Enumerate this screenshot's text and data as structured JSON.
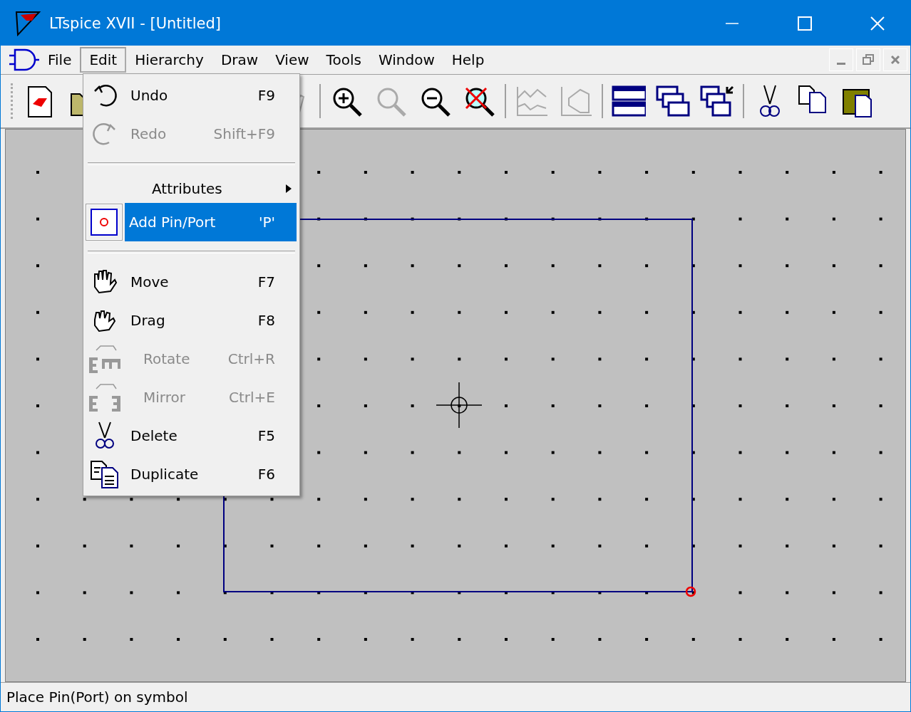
{
  "window": {
    "title": "LTspice XVII - [Untitled]"
  },
  "menu_bar": [
    {
      "label": "File",
      "selected": false
    },
    {
      "label": "Edit",
      "selected": true
    },
    {
      "label": "Hierarchy",
      "selected": false
    },
    {
      "label": "Draw",
      "selected": false
    },
    {
      "label": "View",
      "selected": false
    },
    {
      "label": "Tools",
      "selected": false
    },
    {
      "label": "Window",
      "selected": false
    },
    {
      "label": "Help",
      "selected": false
    }
  ],
  "edit_menu": [
    {
      "kind": "command",
      "label": "Undo",
      "shortcut": "F9",
      "disabled": false,
      "selected": false
    },
    {
      "kind": "command",
      "label": "Redo",
      "shortcut": "Shift+F9",
      "disabled": true,
      "selected": false
    },
    {
      "kind": "separator"
    },
    {
      "kind": "submenu",
      "label": "Attributes",
      "disabled": false,
      "selected": false
    },
    {
      "kind": "command",
      "label": "Add Pin/Port",
      "shortcut": "'P'",
      "disabled": false,
      "selected": true
    },
    {
      "kind": "separator"
    },
    {
      "kind": "command",
      "label": "Move",
      "shortcut": "F7",
      "disabled": false,
      "selected": false
    },
    {
      "kind": "command",
      "label": "Drag",
      "shortcut": "F8",
      "disabled": false,
      "selected": false
    },
    {
      "kind": "command",
      "label": "Rotate",
      "shortcut": "Ctrl+R",
      "disabled": true,
      "selected": false
    },
    {
      "kind": "command",
      "label": "Mirror",
      "shortcut": "Ctrl+E",
      "disabled": true,
      "selected": false
    },
    {
      "kind": "command",
      "label": "Delete",
      "shortcut": "F5",
      "disabled": false,
      "selected": false
    },
    {
      "kind": "command",
      "label": "Duplicate",
      "shortcut": "F6",
      "disabled": false,
      "selected": false
    }
  ],
  "status_bar": {
    "text": "Place Pin(Port) on symbol"
  }
}
